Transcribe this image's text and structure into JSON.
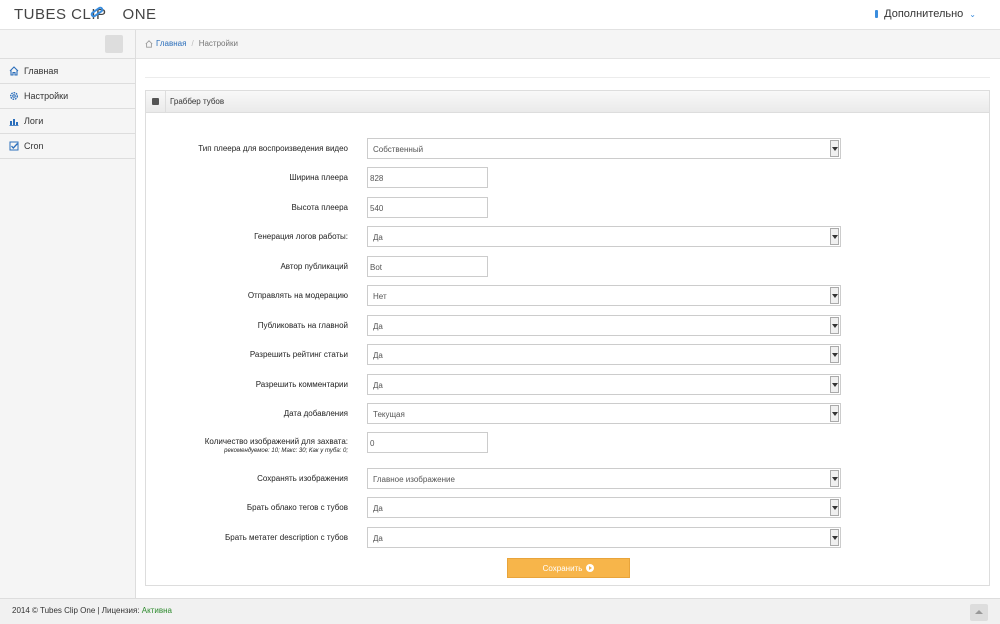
{
  "header": {
    "logo_left": "TUBES CLIP",
    "logo_right": "ONE",
    "more_label": "Дополнительно"
  },
  "sidebar": {
    "items": [
      {
        "label": "Главная",
        "icon": "home-icon"
      },
      {
        "label": "Настройки",
        "icon": "cog-icon"
      },
      {
        "label": "Логи",
        "icon": "bar-chart-icon"
      },
      {
        "label": "Cron",
        "icon": "checkbox-icon"
      }
    ]
  },
  "breadcrumb": {
    "home": "Главная",
    "separator": "/",
    "current": "Настройки"
  },
  "panel": {
    "title": "Граббер тубов"
  },
  "form": {
    "player_type": {
      "label": "Тип плеера для воспроизведения видео",
      "value": "Собственный"
    },
    "player_width": {
      "label": "Ширина плеера",
      "value": "828"
    },
    "player_height": {
      "label": "Высота плеера",
      "value": "540"
    },
    "logging": {
      "label": "Генерация логов работы:",
      "value": "Да"
    },
    "author": {
      "label": "Автор публикаций",
      "value": "Bot"
    },
    "moderation": {
      "label": "Отправлять на модерацию",
      "value": "Нет"
    },
    "publish_main": {
      "label": "Публиковать на главной",
      "value": "Да"
    },
    "allow_rating": {
      "label": "Разрешить рейтинг статьи",
      "value": "Да"
    },
    "allow_comments": {
      "label": "Разрешить комментарии",
      "value": "Да"
    },
    "date_added": {
      "label": "Дата добавления",
      "value": "Текущая"
    },
    "image_count": {
      "label": "Количество изображений для захвата:",
      "hint": "рекомендуемое: 10; Макс: 30; Как у туба: 0;",
      "value": "0"
    },
    "save_images": {
      "label": "Сохранять изображения",
      "value": "Главное изображение"
    },
    "tag_cloud": {
      "label": "Брать облако тегов с тубов",
      "value": "Да"
    },
    "meta_description": {
      "label": "Брать метатег description с тубов",
      "value": "Да"
    },
    "save_label": "Сохранить"
  },
  "footer": {
    "text": "2014 © Tubes Clip One | Лицензия: ",
    "license_status": "Активна"
  },
  "colors": {
    "accent": "#3a8ddd",
    "save_button": "#f7b54a",
    "license_active": "#2e8b2e"
  }
}
